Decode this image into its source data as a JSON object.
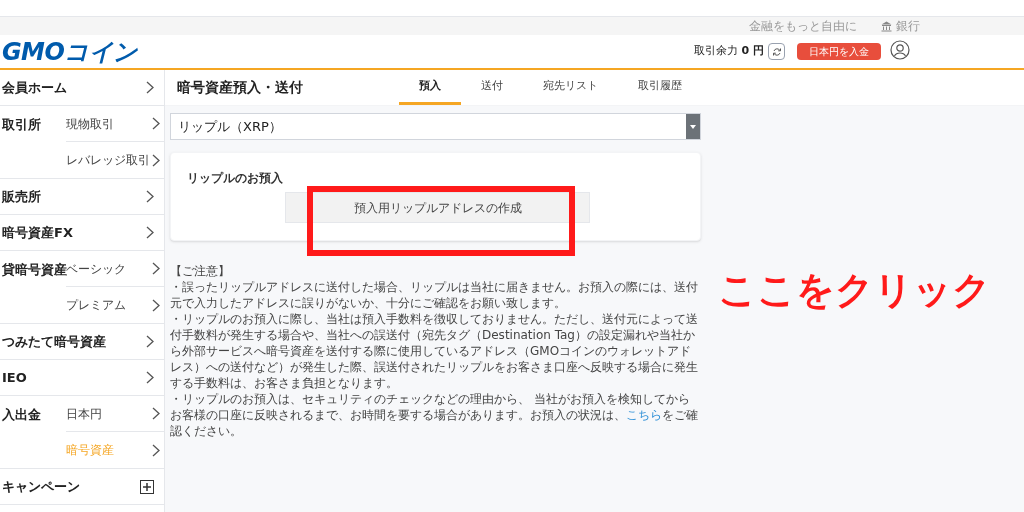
{
  "top_links": [
    {
      "label": "金融をもっと自由に",
      "kind": "text"
    },
    {
      "label": "銀行",
      "kind": "bank"
    }
  ],
  "header": {
    "logo": "GMOコイン",
    "balance_label": "取引余力",
    "balance_value": "0 円",
    "deposit_button": "日本円を入金"
  },
  "sidebar": {
    "items": [
      {
        "label": "会員ホーム",
        "kind": "chevron",
        "selected": false
      },
      {
        "label": "取引所",
        "subitems": [
          {
            "label": "現物取引",
            "selected": false
          },
          {
            "label": "レバレッジ取引",
            "selected": false
          }
        ]
      },
      {
        "label": "販売所",
        "kind": "chevron",
        "selected": false
      },
      {
        "label": "暗号資産FX",
        "kind": "chevron",
        "selected": false
      },
      {
        "label": "貸暗号資産",
        "subitems": [
          {
            "label": "ベーシック",
            "selected": false
          },
          {
            "label": "プレミアム",
            "selected": false
          }
        ]
      },
      {
        "label": "つみたて暗号資産",
        "kind": "chevron",
        "selected": false
      },
      {
        "label": "IEO",
        "kind": "chevron",
        "selected": false
      },
      {
        "label": "入出金",
        "subitems": [
          {
            "label": "日本円",
            "selected": false
          },
          {
            "label": "暗号資産",
            "selected": true
          }
        ]
      },
      {
        "label": "キャンペーン",
        "kind": "plus",
        "selected": false
      }
    ]
  },
  "page_title": "暗号資産預入・送付",
  "tabs": [
    {
      "label": "預入",
      "selected": true
    },
    {
      "label": "送付",
      "selected": false
    },
    {
      "label": "宛先リスト",
      "selected": false
    },
    {
      "label": "取引履歴",
      "selected": false
    }
  ],
  "currency_select": {
    "value": "リップル（XRP）"
  },
  "card": {
    "title": "リップルのお預入",
    "button": "預入用リップルアドレスの作成"
  },
  "notice": {
    "title": "【ご注意】",
    "items": [
      {
        "text": "・誤ったリップルアドレスに送付した場合、リップルは当社に届きません。お預入の際には、送付元で入力したアドレスに誤りがないか、十分にご確認をお願い致します。"
      },
      {
        "text": "・リップルのお預入に際し、当社は預入手数料を徴収しておりません。ただし、送付元によって送付手数料が発生する場合や、当社への誤送付（宛先タグ（Destination Tag）の設定漏れや当社から外部サービスへ暗号資産を送付する際に使用しているアドレス（GMOコインのウォレットアドレス）への送付など）が発生した際、誤送付されたリップルをお客さま口座へ反映する場合に発生する手数料は、お客さま負担となります。"
      },
      {
        "text": "・リップルのお預入は、セキュリティのチェックなどの理由から、 当社がお預入を検知してからお客様の口座に反映されるまで、お時間を要する場合があります。お預入の状況は、",
        "link": "こちら",
        "after": "をご確認ください。"
      }
    ]
  },
  "annotation": {
    "text": "ここをクリック"
  }
}
